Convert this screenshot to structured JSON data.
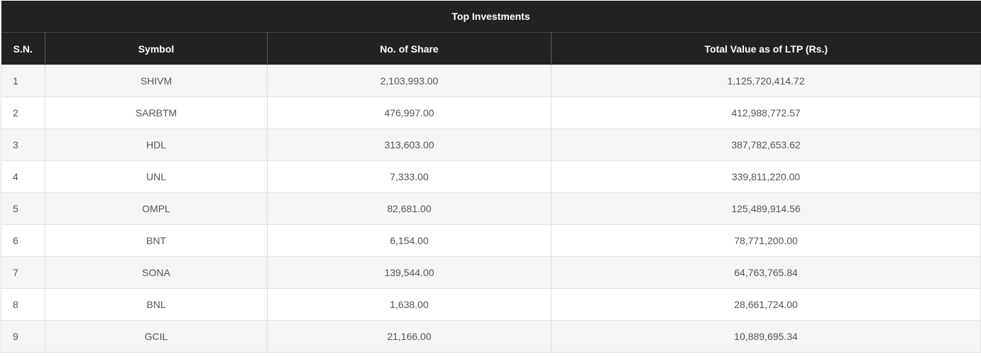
{
  "table": {
    "title": "Top Investments",
    "headers": {
      "sn": "S.N.",
      "symbol": "Symbol",
      "shares": "No. of Share",
      "value": "Total Value as of LTP (Rs.)"
    },
    "rows": [
      {
        "sn": "1",
        "symbol": "SHIVM",
        "shares": "2,103,993.00",
        "value": "1,125,720,414.72"
      },
      {
        "sn": "2",
        "symbol": "SARBTM",
        "shares": "476,997.00",
        "value": "412,988,772.57"
      },
      {
        "sn": "3",
        "symbol": "HDL",
        "shares": "313,603.00",
        "value": "387,782,653.62"
      },
      {
        "sn": "4",
        "symbol": "UNL",
        "shares": "7,333.00",
        "value": "339,811,220.00"
      },
      {
        "sn": "5",
        "symbol": "OMPL",
        "shares": "82,681.00",
        "value": "125,489,914.56"
      },
      {
        "sn": "6",
        "symbol": "BNT",
        "shares": "6,154.00",
        "value": "78,771,200.00"
      },
      {
        "sn": "7",
        "symbol": "SONA",
        "shares": "139,544.00",
        "value": "64,763,765.84"
      },
      {
        "sn": "8",
        "symbol": "BNL",
        "shares": "1,638.00",
        "value": "28,661,724.00"
      },
      {
        "sn": "9",
        "symbol": "GCIL",
        "shares": "21,166.00",
        "value": "10,889,695.34"
      }
    ]
  }
}
